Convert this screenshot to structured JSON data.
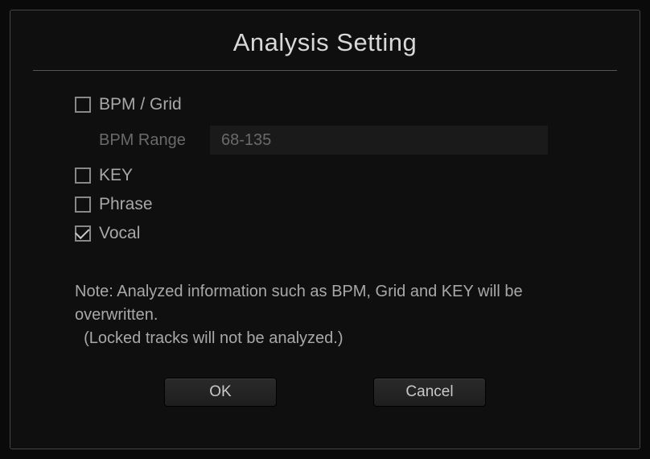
{
  "dialog": {
    "title": "Analysis Setting"
  },
  "options": {
    "bpm_grid": {
      "label": "BPM / Grid",
      "checked": false
    },
    "bpm_range": {
      "label": "BPM Range",
      "value": "68-135"
    },
    "key": {
      "label": "KEY",
      "checked": false
    },
    "phrase": {
      "label": "Phrase",
      "checked": false
    },
    "vocal": {
      "label": "Vocal",
      "checked": true
    }
  },
  "note": {
    "line1": "Note: Analyzed information such as BPM, Grid and KEY will be overwritten.",
    "line2": "  (Locked tracks will not be analyzed.)"
  },
  "buttons": {
    "ok": "OK",
    "cancel": "Cancel"
  }
}
